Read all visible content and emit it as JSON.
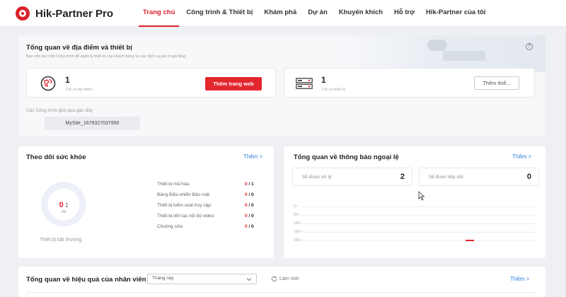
{
  "header": {
    "logo_text": "Hik-Partner Pro",
    "nav": [
      {
        "label": "Trang chủ",
        "active": true
      },
      {
        "label": "Công trình & Thiết bị"
      },
      {
        "label": "Khám phá"
      },
      {
        "label": "Dự án"
      },
      {
        "label": "Khuyến khích"
      },
      {
        "label": "Hỗ trợ"
      },
      {
        "label": "Hik-Partner của tôi"
      }
    ]
  },
  "overview": {
    "title": "Tổng quan về địa điểm và thiết bị",
    "subtitle": "Bạn nên tạo một Công trình để quản lý thiết bị của khách hàng và các dịch vụ giá trị gia tăng.",
    "help_icon": "?",
    "sites": {
      "count": "1",
      "label": "Tất cả địa điểm",
      "button": "Thêm trang web"
    },
    "devices": {
      "count": "1",
      "label": "Tất cả thiết bị",
      "button": "Thêm thiế..."
    },
    "recent_label": "Các Công trình ghé qua gần đây",
    "recent_site": "MySite_1679327037950"
  },
  "health": {
    "title": "Theo dõi sức khỏe",
    "more": "Thêm  >",
    "donut_abnormal": "0",
    "donut_total": "1",
    "donut_sub": "All",
    "abnormal_label": "Thiết bị bất thường",
    "rows": [
      {
        "label": "Thiết bị mã hóa:",
        "abn": "0",
        "total": "/ 1"
      },
      {
        "label": "Bảng Điều khiển Bảo mật:",
        "abn": "0",
        "total": "/ 0"
      },
      {
        "label": "Thiết bị kiểm soát truy cập:",
        "abn": "0",
        "total": "/ 0"
      },
      {
        "label": "Thiết bị liên lạc nội bộ video:",
        "abn": "0",
        "total": "/ 0"
      },
      {
        "label": "Chuông cửa:",
        "abn": "0",
        "total": "/ 0"
      }
    ],
    "accent": "#e4262f"
  },
  "exceptions": {
    "title": "Tổng quan về thông báo ngoại lệ",
    "more": "Thêm  >",
    "to_process_label": "Sẽ được xử lý:",
    "to_process_value": "2",
    "to_follow_label": "Sẽ được tiếp nối:",
    "to_follow_value": "0",
    "y_ticks": [
      "200",
      "150",
      "100",
      "50",
      "0"
    ]
  },
  "chart_data": {
    "type": "bar",
    "categories": [
      ""
    ],
    "values": [
      0
    ],
    "ylim": [
      0,
      200
    ],
    "yticks": [
      0,
      50,
      100,
      150,
      200
    ],
    "grid": true,
    "bar_color": "#e4262f",
    "bar_position_fraction": 0.85
  },
  "performance": {
    "title": "Tổng quan về hiệu quả của nhân viên",
    "period": "Tháng này",
    "refresh": "Làm mới",
    "more": "Thêm  >"
  }
}
